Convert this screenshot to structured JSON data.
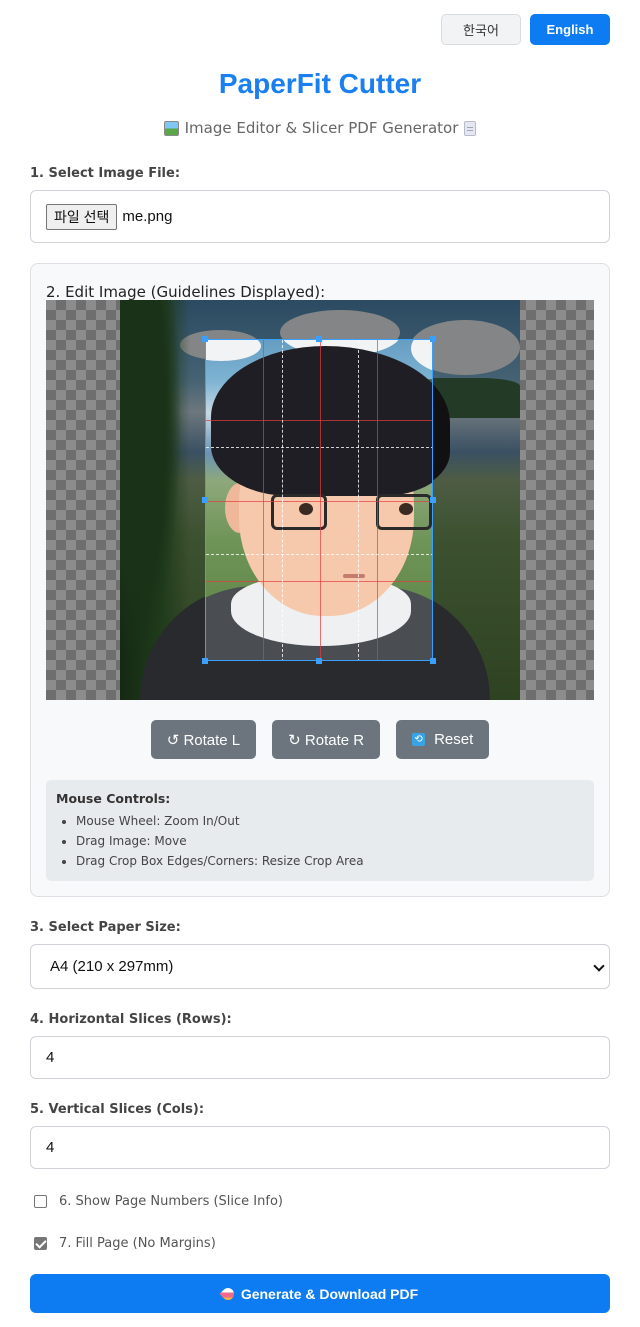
{
  "language": {
    "korean_label": "한국어",
    "english_label": "English",
    "active": "English"
  },
  "header": {
    "title": "PaperFit Cutter",
    "subtitle": "Image Editor & Slicer PDF Generator"
  },
  "step1": {
    "label": "1. Select Image File:",
    "button_label": "파일 선택",
    "file_name": "me.png"
  },
  "step2": {
    "label": "2. Edit Image (Guidelines Displayed):",
    "buttons": {
      "rotate_left": "↺ Rotate L",
      "rotate_right": "↻ Rotate R",
      "reset": "Reset"
    },
    "help_title": "Mouse Controls:",
    "help_items": [
      "Mouse Wheel: Zoom In/Out",
      "Drag Image: Move",
      "Drag Crop Box Edges/Corners: Resize Crop Area"
    ]
  },
  "step3": {
    "label": "3. Select Paper Size:",
    "selected": "A4 (210 x 297mm)"
  },
  "step4": {
    "label": "4. Horizontal Slices (Rows):",
    "value": "4"
  },
  "step5": {
    "label": "5. Vertical Slices (Cols):",
    "value": "4"
  },
  "step6": {
    "label": "6. Show Page Numbers (Slice Info)",
    "checked": false
  },
  "step7": {
    "label": "7. Fill Page (No Margins)",
    "checked": true
  },
  "generate": {
    "label": "Generate & Download PDF"
  },
  "colors": {
    "accent": "#0d7cf2",
    "title": "#1a7ff0",
    "tool_button": "#6c757d",
    "crop_border": "#39a0ff"
  },
  "icons": {
    "subtitle_left": "framed-picture-icon",
    "subtitle_right": "page-icon",
    "reset": "counterclockwise-arrows-icon",
    "generate": "rocket-icon"
  }
}
